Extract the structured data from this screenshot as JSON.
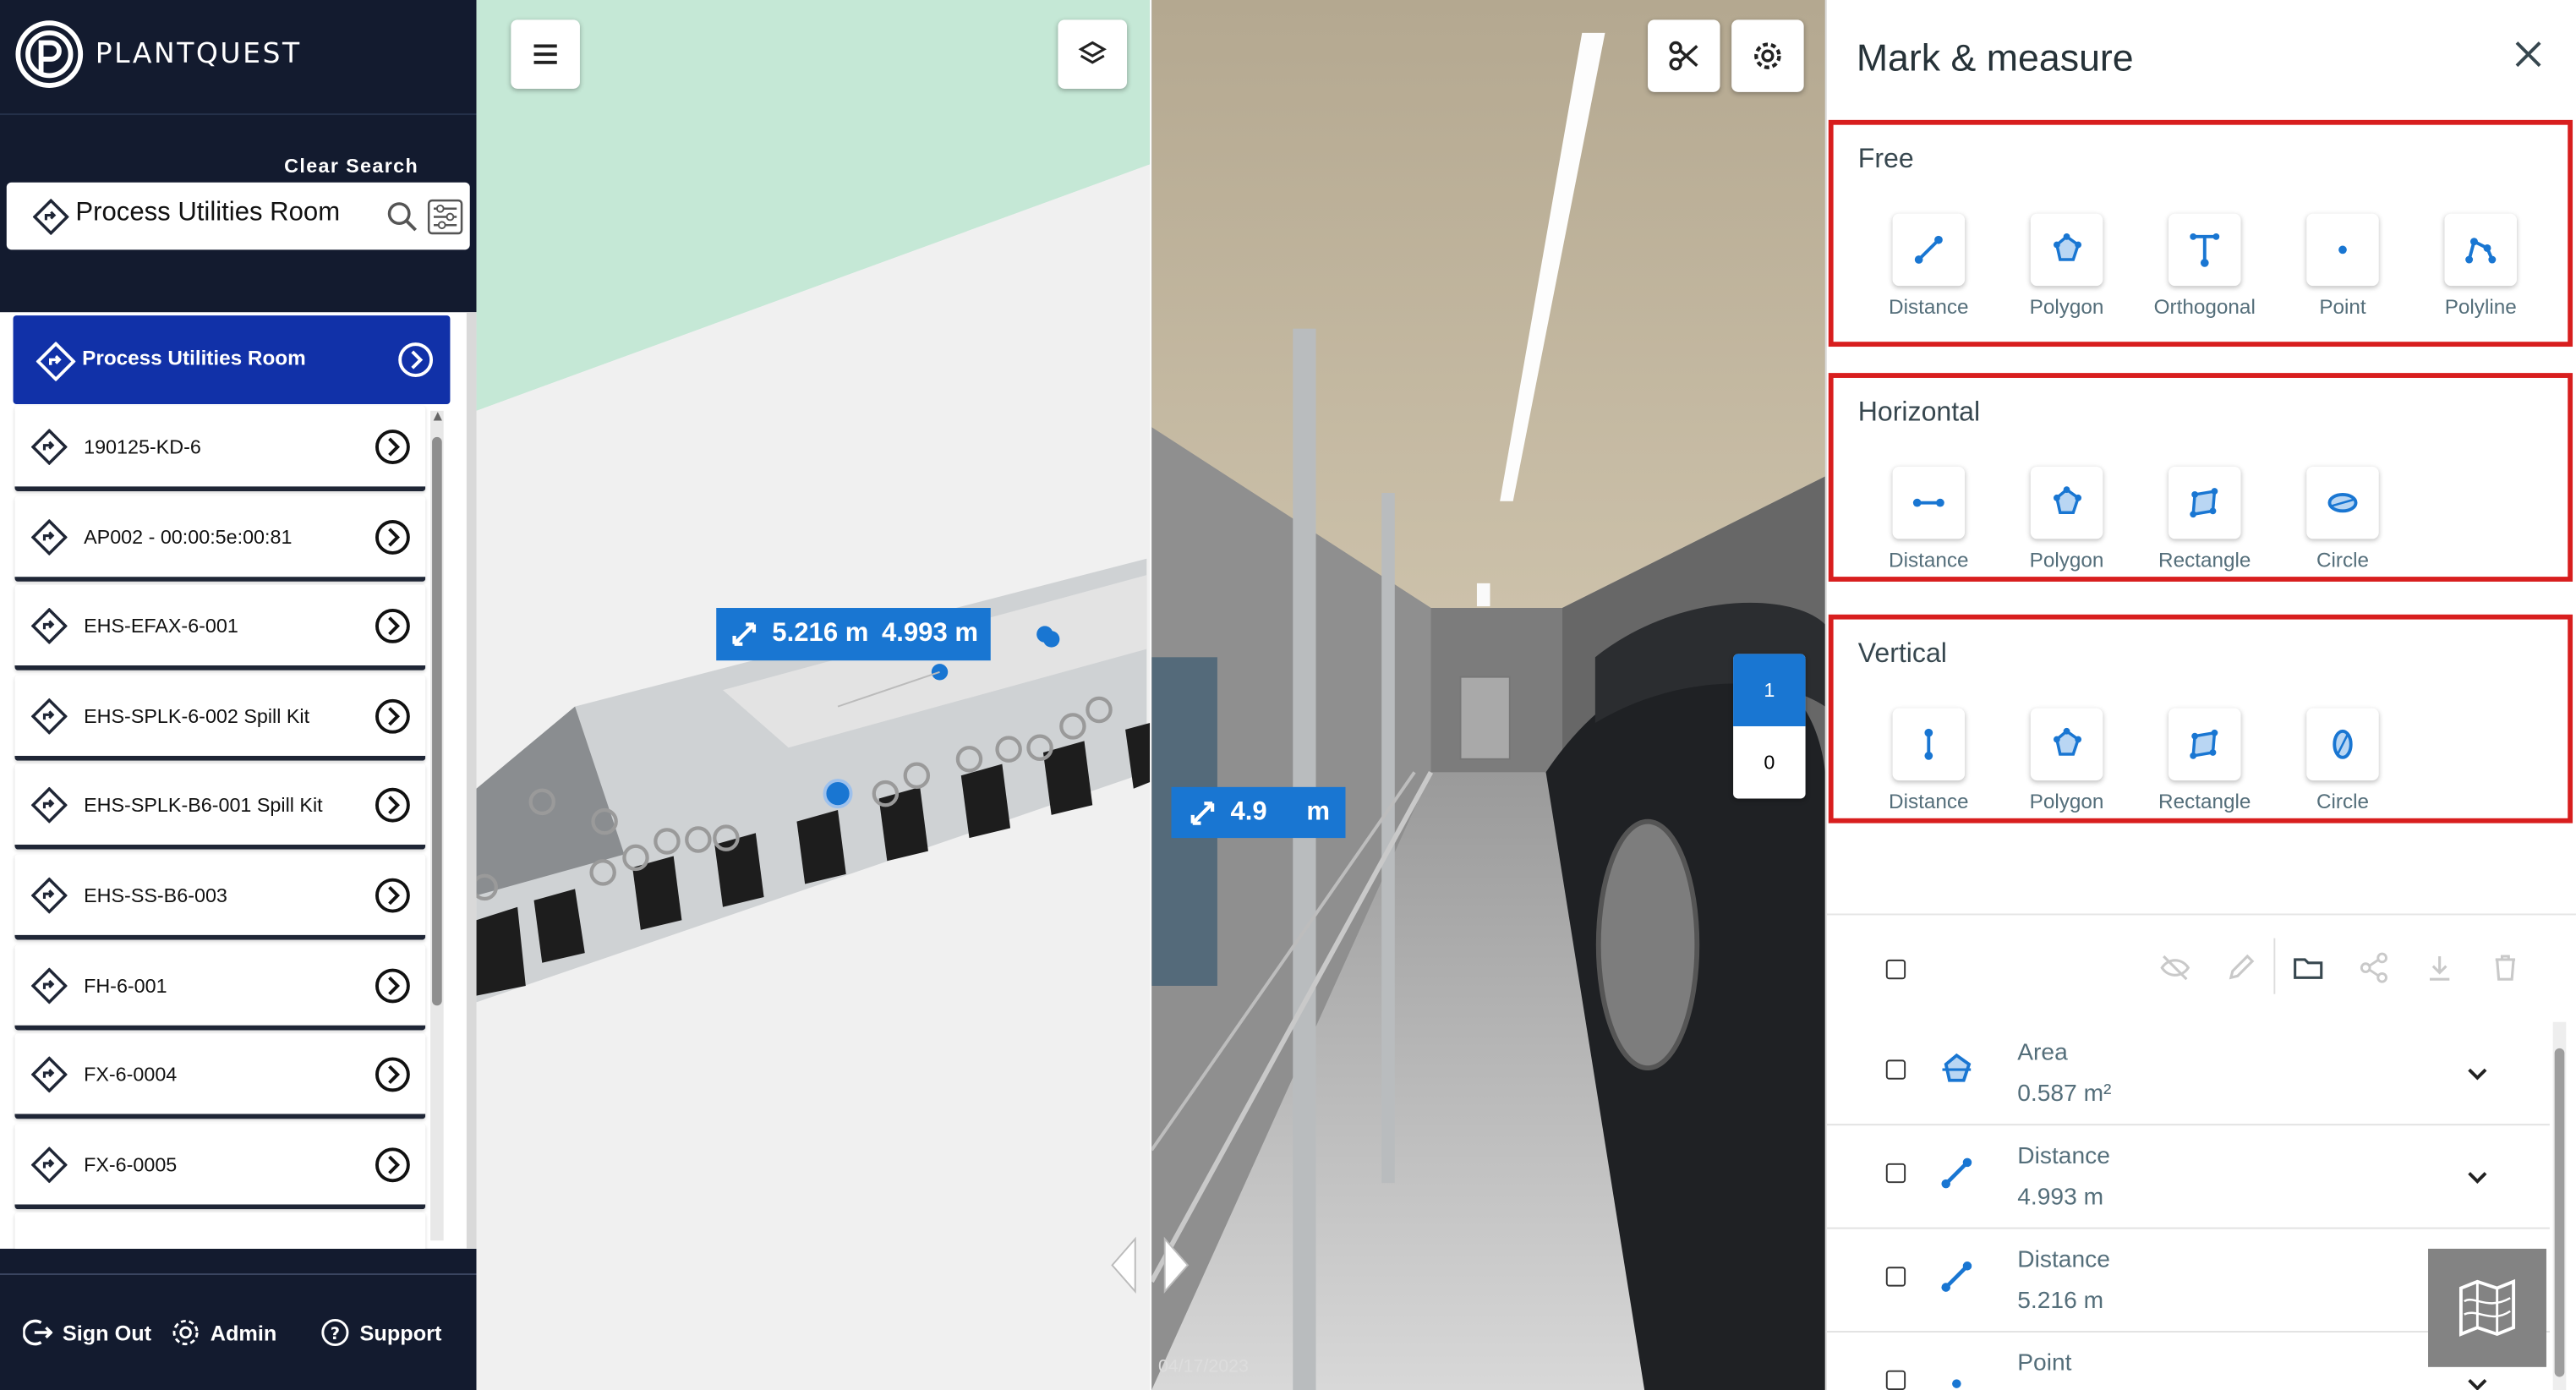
{
  "app": {
    "brand": "PLANTQUEST"
  },
  "search": {
    "clear_label": "Clear Search",
    "value": "Process Utilities Room"
  },
  "results": {
    "header": "Process Utilities Room",
    "items": [
      {
        "label": "190125-KD-6"
      },
      {
        "label": "AP002 - 00:00:5e:00:81"
      },
      {
        "label": "EHS-EFAX-6-001"
      },
      {
        "label": "EHS-SPLK-6-002 Spill Kit"
      },
      {
        "label": "EHS-SPLK-B6-001 Spill Kit"
      },
      {
        "label": "EHS-SS-B6-003"
      },
      {
        "label": "FH-6-001"
      },
      {
        "label": "FX-6-0004"
      },
      {
        "label": "FX-6-0005"
      }
    ]
  },
  "footer": {
    "sign_out": "Sign Out",
    "admin": "Admin",
    "support": "Support"
  },
  "map": {
    "measure_a": "5.216 m",
    "measure_b": "4.993 m"
  },
  "pano": {
    "floor_active": "1",
    "floor_other": "0",
    "date": "04/17/2023",
    "measure_prefix": "4.9",
    "measure_suffix": "m"
  },
  "panel": {
    "title": "Mark & measure",
    "groups": [
      {
        "title": "Free",
        "tools": [
          "Distance",
          "Polygon",
          "Orthogonal",
          "Point",
          "Polyline"
        ]
      },
      {
        "title": "Horizontal",
        "tools": [
          "Distance",
          "Polygon",
          "Rectangle",
          "Circle"
        ]
      },
      {
        "title": "Vertical",
        "tools": [
          "Distance",
          "Polygon",
          "Rectangle",
          "Circle"
        ]
      }
    ],
    "measurements": [
      {
        "type": "Area",
        "value": "0.587 m²",
        "icon": "polygon-icon"
      },
      {
        "type": "Distance",
        "value": "4.993 m",
        "icon": "distance-icon"
      },
      {
        "type": "Distance",
        "value": "5.216 m",
        "icon": "distance-icon"
      },
      {
        "type": "Point",
        "value": "",
        "icon": "point-icon"
      }
    ]
  },
  "colors": {
    "sidebar": "#131b2f",
    "accent": "#1131a8",
    "blue": "#1976d2",
    "highlight": "#d81e1e"
  }
}
